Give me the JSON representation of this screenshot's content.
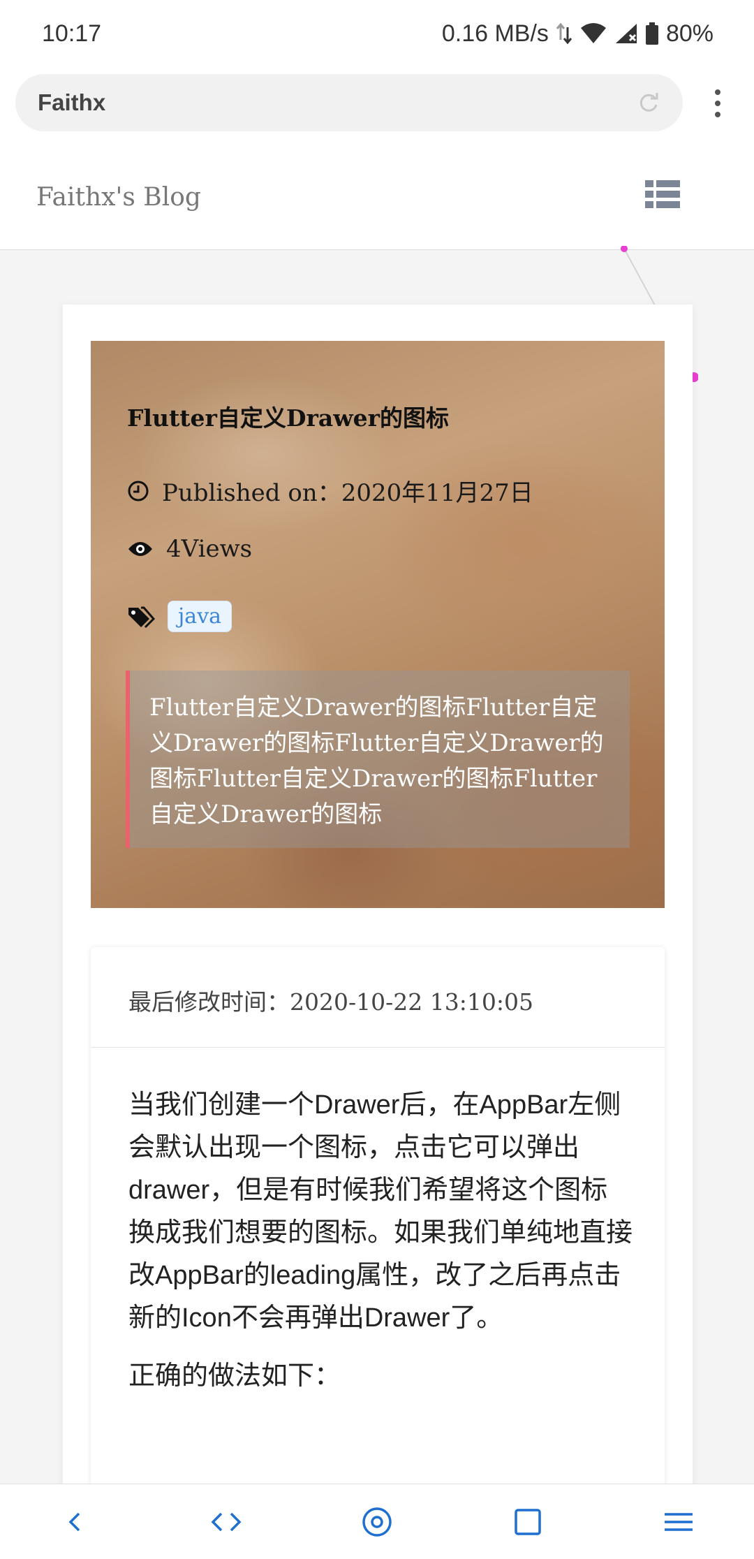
{
  "status_bar": {
    "time": "10:17",
    "net_speed": "0.16 MB/s",
    "battery": "80%",
    "icons": [
      "data-arrows-icon",
      "wifi-icon",
      "signal-icon",
      "battery-icon"
    ]
  },
  "browser": {
    "url_text": "Faithx",
    "reload_icon": "reload-icon",
    "menu_icon": "more-vert-icon"
  },
  "site": {
    "title": "Faithx's Blog",
    "menu_icon": "list-menu-icon"
  },
  "post": {
    "title": "Flutter自定义Drawer的图标",
    "published": "Published on：2020年11月27日",
    "views": "4Views",
    "tags": [
      "java"
    ],
    "excerpt": "Flutter自定义Drawer的图标Flutter自定义Drawer的图标Flutter自定义Drawer的图标Flutter自定义Drawer的图标Flutter自定义Drawer的图标",
    "last_modified": "最后修改时间：2020-10-22 13:10:05",
    "paragraph_1": "当我们创建一个Drawer后，在AppBar左侧会默认出现一个图标，点击它可以弹出drawer，但是有时候我们希望将这个图标换成我们想要的图标。如果我们单纯地直接改AppBar的leading属性，改了之后再点击新的Icon不会再弹出Drawer了。",
    "paragraph_2": "正确的做法如下："
  },
  "bottom_nav": [
    "back-icon",
    "code-icon",
    "home-circle-icon",
    "tabs-square-icon",
    "menu-lines-icon"
  ],
  "colors": {
    "accent_particle": "#e83fd1",
    "tag_text": "#3b86d6",
    "excerpt_border": "#e8636b",
    "nav_icon": "#1e6fcf"
  }
}
